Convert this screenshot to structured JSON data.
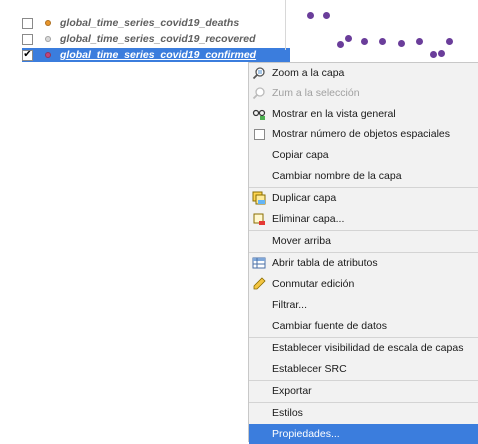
{
  "layers": [
    {
      "name": "global_time_series_covid19_deaths",
      "checked": false,
      "dot_color": "#e8952b"
    },
    {
      "name": "global_time_series_covid19_recovered",
      "checked": false,
      "dot_color": "#d9d9d9"
    },
    {
      "name": "global_time_series_covid19_confirmed",
      "checked": true,
      "check_mark": "✔",
      "dot_color": "#c1457a"
    }
  ],
  "context_menu": {
    "items": [
      {
        "label": "Zoom a la capa",
        "icon": "zoom-layer-icon"
      },
      {
        "label": "Zum a la selección",
        "icon": "zoom-selection-icon",
        "disabled": true
      },
      {
        "label": "Mostrar en la vista general",
        "icon": "overview-icon"
      },
      {
        "label": "Mostrar número de objetos espaciales",
        "icon": "checkbox-icon"
      },
      {
        "label": "Copiar capa"
      },
      {
        "label": "Cambiar nombre de la capa"
      },
      {
        "label": "Duplicar capa",
        "icon": "duplicate-layer-icon"
      },
      {
        "label": "Eliminar capa...",
        "icon": "remove-layer-icon"
      },
      {
        "label": "Mover arriba"
      },
      {
        "label": "Abrir tabla de atributos",
        "icon": "attribute-table-icon"
      },
      {
        "label": "Conmutar edición",
        "icon": "pencil-icon"
      },
      {
        "label": "Filtrar..."
      },
      {
        "label": "Cambiar fuente de datos"
      },
      {
        "label": "Establecer visibilidad de escala de capas"
      },
      {
        "label": "Establecer SRC"
      },
      {
        "label": "Exportar"
      },
      {
        "label": "Estilos"
      },
      {
        "label": "Propiedades...",
        "highlighted": true
      }
    ]
  },
  "map": {
    "point_color": "#6a3d9a"
  }
}
